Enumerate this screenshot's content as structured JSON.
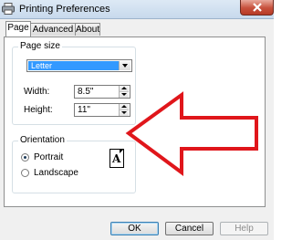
{
  "window": {
    "title": "Printing Preferences",
    "title_icon": "printer-icon",
    "close_icon": "close-icon"
  },
  "tabs": [
    {
      "label": "Page",
      "active": true
    },
    {
      "label": "Advanced",
      "active": false
    },
    {
      "label": "About",
      "active": false
    }
  ],
  "paper_size": {
    "legend": "Page size",
    "selected": "Letter",
    "width_label": "Width:",
    "width_value": "8.5\"",
    "height_label": "Height:",
    "height_value": "11\""
  },
  "orientation": {
    "legend": "Orientation",
    "options": [
      {
        "label": "Portrait",
        "selected": true
      },
      {
        "label": "Landscape",
        "selected": false
      }
    ],
    "preview_glyph": "A"
  },
  "annotation": {
    "icon": "red-arrow-icon",
    "color": "#e0161b"
  },
  "buttons": {
    "ok": "OK",
    "cancel": "Cancel",
    "help": "Help"
  },
  "colors": {
    "selection": "#3399ff",
    "close_button": "#c7503c"
  }
}
